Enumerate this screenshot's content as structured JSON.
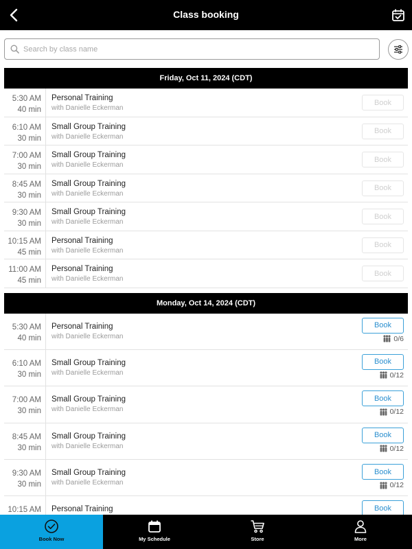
{
  "header": {
    "title": "Class booking",
    "back_icon": "chevron-left-icon",
    "calendar_icon": "calendar-check-icon"
  },
  "search": {
    "placeholder": "Search by class name",
    "value": ""
  },
  "days": [
    {
      "label": "Friday, Oct 11, 2024 (CDT)",
      "classes": [
        {
          "time": "5:30  AM",
          "duration": "40 min",
          "name": "Personal Training",
          "instructor": "with Danielle Eckerman",
          "book": "Book"
        },
        {
          "time": "6:10  AM",
          "duration": "30 min",
          "name": "Small Group Training",
          "instructor": "with Danielle Eckerman",
          "book": "Book"
        },
        {
          "time": "7:00  AM",
          "duration": "30 min",
          "name": "Small Group Training",
          "instructor": "with Danielle Eckerman",
          "book": "Book"
        },
        {
          "time": "8:45  AM",
          "duration": "30 min",
          "name": "Small Group Training",
          "instructor": "with Danielle Eckerman",
          "book": "Book"
        },
        {
          "time": "9:30  AM",
          "duration": "30 min",
          "name": "Small Group Training",
          "instructor": "with Danielle Eckerman",
          "book": "Book"
        },
        {
          "time": "10:15  AM",
          "duration": "45 min",
          "name": "Personal Training",
          "instructor": "with Danielle Eckerman",
          "book": "Book"
        },
        {
          "time": "11:00  AM",
          "duration": "45 min",
          "name": "Personal Training",
          "instructor": "with Danielle Eckerman",
          "book": "Book"
        }
      ]
    },
    {
      "label": "Monday, Oct 14, 2024 (CDT)",
      "classes": [
        {
          "time": "5:30  AM",
          "duration": "40 min",
          "name": "Personal Training",
          "instructor": "with Danielle Eckerman",
          "book": "Book",
          "capacity": "0/6"
        },
        {
          "time": "6:10  AM",
          "duration": "30 min",
          "name": "Small Group Training",
          "instructor": "with Danielle Eckerman",
          "book": "Book",
          "capacity": "0/12"
        },
        {
          "time": "7:00  AM",
          "duration": "30 min",
          "name": "Small Group Training",
          "instructor": "with Danielle Eckerman",
          "book": "Book",
          "capacity": "0/12"
        },
        {
          "time": "8:45  AM",
          "duration": "30 min",
          "name": "Small Group Training",
          "instructor": "with Danielle Eckerman",
          "book": "Book",
          "capacity": "0/12"
        },
        {
          "time": "9:30  AM",
          "duration": "30 min",
          "name": "Small Group Training",
          "instructor": "with Danielle Eckerman",
          "book": "Book",
          "capacity": "0/12"
        },
        {
          "time": "10:15  AM",
          "duration": "",
          "name": "Personal Training",
          "instructor": "",
          "book": "Book"
        }
      ]
    }
  ],
  "tabs": [
    {
      "label": "Book Now",
      "icon": "check-circle-icon",
      "active": true
    },
    {
      "label": "My Schedule",
      "icon": "calendar-icon",
      "active": false
    },
    {
      "label": "Store",
      "icon": "cart-icon",
      "active": false
    },
    {
      "label": "More",
      "icon": "person-icon",
      "active": false
    }
  ],
  "colors": {
    "accent": "#0aa1e0",
    "book_active": "#2b8fcf",
    "bar": "#000000"
  }
}
